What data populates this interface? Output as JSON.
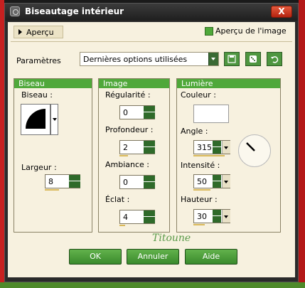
{
  "window": {
    "title": "Biseautage intérieur",
    "close_label": "X"
  },
  "toolbar": {
    "preview_label": "Aperçu",
    "image_preview_label": "Aperçu de l'image",
    "image_preview_checked": true
  },
  "params": {
    "label": "Paramètres",
    "preset_value": "Dernières options utilisées"
  },
  "bevel_group": {
    "title": "Biseau",
    "bevel_label": "Biseau :",
    "width_label": "Largeur :",
    "width_value": "8"
  },
  "image_group": {
    "title": "Image",
    "regularity_label": "Régularité :",
    "regularity_value": "0",
    "depth_label": "Profondeur :",
    "depth_value": "2",
    "ambiance_label": "Ambiance :",
    "ambiance_value": "0",
    "shine_label": "Éclat :",
    "shine_value": "4"
  },
  "light_group": {
    "title": "Lumière",
    "color_label": "Couleur :",
    "color_value": "#ffffff",
    "angle_label": "Angle :",
    "angle_value": "315",
    "intensity_label": "Intensité :",
    "intensity_value": "50",
    "height_label": "Hauteur :",
    "height_value": "30"
  },
  "watermark": "Titoune",
  "buttons": {
    "ok": "OK",
    "cancel": "Annuler",
    "help": "Aide"
  },
  "colors": {
    "accent_green": "#4fa83a",
    "panel_bg": "#f7f1df",
    "title_bar": "#2a2a2a",
    "close_red": "#c8361c"
  }
}
